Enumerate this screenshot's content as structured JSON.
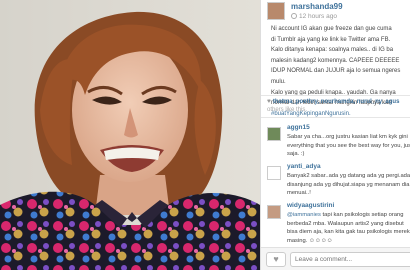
{
  "post": {
    "username": "marshanda99",
    "time_ago": "12 hours ago",
    "caption_lines": [
      "Ni account IG akan gue freeze dan gue cuma",
      "di Tumblr aja yang ke link ke Twitter ama FB.",
      "Kalo ditanya kenapa: soalnya males.. di IG ba",
      "malesin kadang2 komennya. CAPEEE DEEEEE",
      "IDUP NORMAL dan JUJUR aja lo semua ngeres",
      "mulu.",
      "Kalo yang ga peduli knapa.. yaudah. Ga nanya",
      "normal dan lebih santai mungkin Idupnya kan"
    ],
    "hashtag": "#buatYangKepinganNgurusin."
  },
  "likes": {
    "names": "thatma_poethry, nourhamda, nurul_ny_agus",
    "others": "others like this."
  },
  "comments": [
    {
      "username": "aggn15",
      "lines": [
        "Sabar ya cha...org justru kasian liat km kyk gini",
        "everything that you see the best way for you, just",
        "saja. :)"
      ]
    },
    {
      "username": "yanti_adya",
      "lines": [
        "Banyak2 sabar..ada yg datang ada yg pergi.ada",
        "disanjung ada yg dihujat.siapa yg menanam dia",
        "menuai..!"
      ]
    },
    {
      "username": "widyaagustirini",
      "mention": "@iammanies",
      "lines": [
        " tapi kan psikologis setiap orang",
        "berbeda2 mba. Walaupun artis2 yang disebut",
        "bisa diem aja, kan kita gak tau psikologis mereka",
        "masing. ☺☺☺☺"
      ]
    }
  ],
  "footer": {
    "comment_placeholder": "Leave a comment..."
  },
  "icons": {
    "clock": "clock-icon",
    "heart": "heart-icon",
    "like": "heart-icon"
  },
  "colors": {
    "link": "#3f729b",
    "text": "#444444",
    "muted": "#999999"
  }
}
